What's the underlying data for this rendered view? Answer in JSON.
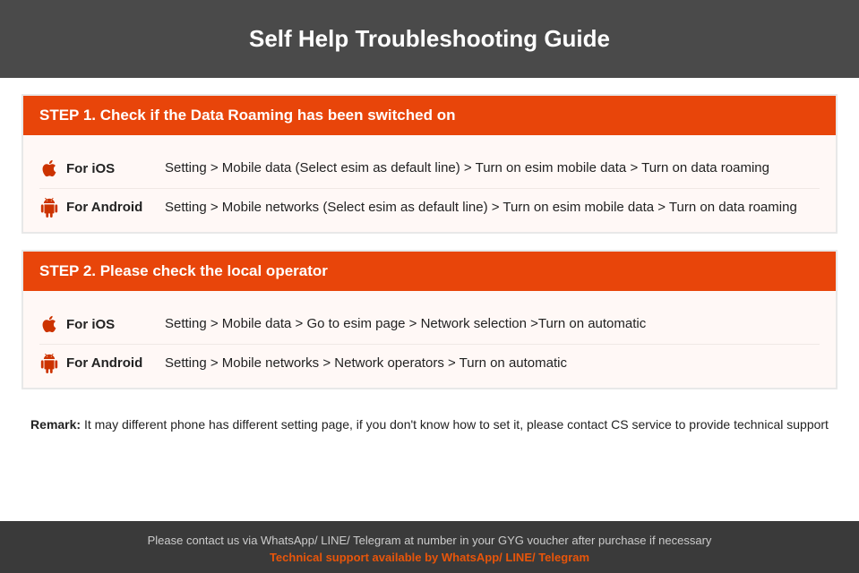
{
  "header": {
    "title": "Self Help Troubleshooting Guide",
    "bg": "#4a4a4a"
  },
  "steps": [
    {
      "id": "step1",
      "header": "STEP 1.  Check if the Data Roaming has been switched on",
      "platforms": [
        {
          "os": "ios",
          "label": "For iOS",
          "desc": "Setting > Mobile data (Select esim as default line) > Turn on esim mobile data > Turn on data roaming"
        },
        {
          "os": "android",
          "label": "For Android",
          "desc": "Setting > Mobile networks (Select esim as default line) > Turn on esim mobile data > Turn on data roaming"
        }
      ]
    },
    {
      "id": "step2",
      "header": "STEP 2.  Please check the local operator",
      "platforms": [
        {
          "os": "ios",
          "label": "For iOS",
          "desc": "Setting > Mobile data > Go to esim page > Network selection >Turn on automatic"
        },
        {
          "os": "android",
          "label": "For Android",
          "desc": "Setting > Mobile networks > Network operators > Turn on automatic"
        }
      ]
    }
  ],
  "remark": {
    "prefix": "Remark:",
    "text": " It may different phone has different setting page, if you don't know how to set it,  please contact CS service to provide technical support"
  },
  "footer": {
    "main_text": "Please contact us via WhatsApp/ LINE/ Telegram at number in your GYG voucher after purchase if necessary",
    "support_text": "Technical support available by WhatsApp/ LINE/ Telegram"
  }
}
